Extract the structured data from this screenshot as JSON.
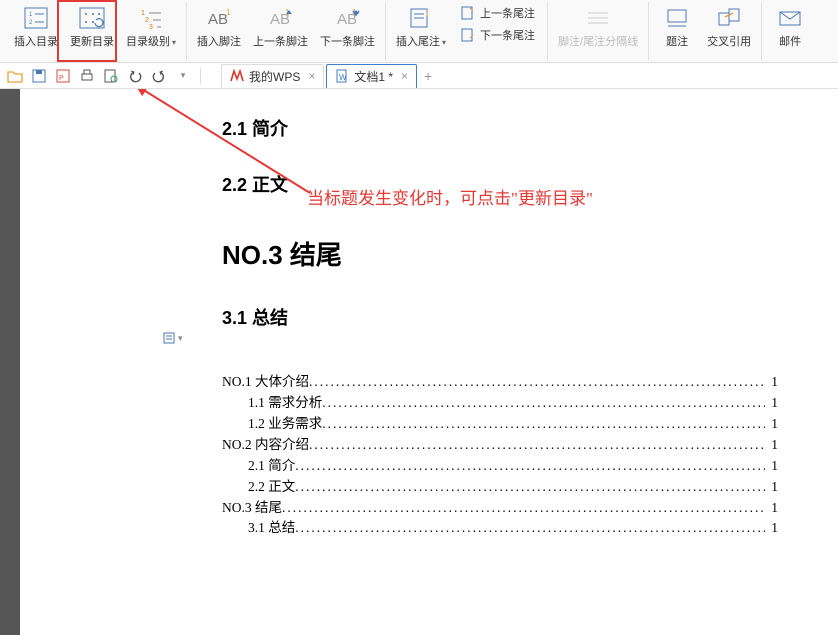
{
  "ribbon": {
    "insert_toc": "插入目录",
    "update_toc": "更新目录",
    "toc_level": "目录级别",
    "insert_footnote": "插入脚注",
    "prev_footnote": "上一条脚注",
    "next_footnote": "下一条脚注",
    "insert_endnote": "插入尾注",
    "prev_endnote": "上一条尾注",
    "next_endnote": "下一条尾注",
    "separator": "脚注/尾注分隔线",
    "caption": "题注",
    "cross_ref": "交叉引用",
    "mail": "邮件"
  },
  "tabs": {
    "wps_home": "我的WPS",
    "doc1": "文档1 *",
    "add": "+"
  },
  "annotation": "当标题发生变化时，可点击\"更新目录\"",
  "doc": {
    "h21": "2.1 简介",
    "h22": "2.2 正文",
    "hno3": "NO.3 结尾",
    "h31": "3.1 总结"
  },
  "toc": [
    {
      "title": "NO.1 大体介绍",
      "indent": 0,
      "page": "1"
    },
    {
      "title": "1.1 需求分析",
      "indent": 1,
      "page": "1"
    },
    {
      "title": "1.2 业务需求",
      "indent": 1,
      "page": "1"
    },
    {
      "title": "NO.2 内容介绍",
      "indent": 0,
      "page": "1"
    },
    {
      "title": "2.1 简介",
      "indent": 1,
      "page": "1"
    },
    {
      "title": "2.2 正文",
      "indent": 1,
      "page": "1"
    },
    {
      "title": "NO.3 结尾",
      "indent": 0,
      "page": "1"
    },
    {
      "title": "3.1 总结",
      "indent": 1,
      "page": "1"
    }
  ]
}
